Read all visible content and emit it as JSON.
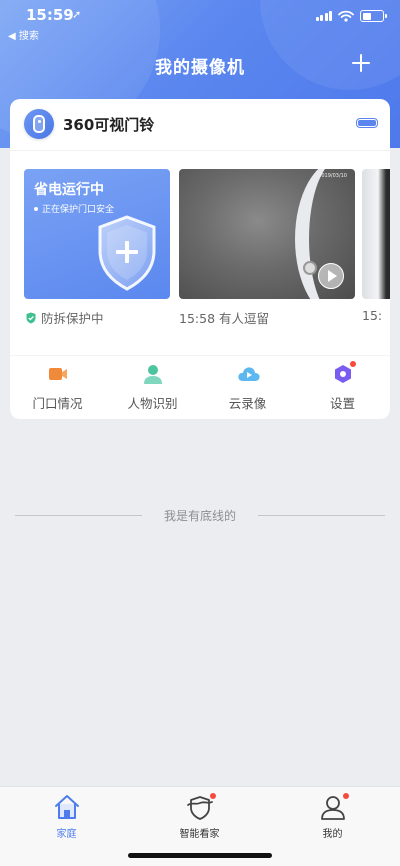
{
  "status_bar": {
    "time": "15:59",
    "back_label": "◀ 搜索"
  },
  "header": {
    "title": "我的摄像机",
    "add_icon": "plus-icon"
  },
  "device": {
    "name": "360可视门铃",
    "icon": "doorbell-icon",
    "battery_icon": "battery-full-icon"
  },
  "tiles": {
    "status": {
      "title": "省电运行中",
      "subtitle": "正在保护门口安全",
      "caption": "防拆保护中"
    },
    "video1": {
      "stamp": "2019/03/10",
      "caption": "15:58 有人逗留"
    },
    "video2": {
      "caption": "15:"
    }
  },
  "features": [
    {
      "label": "门口情况",
      "icon": "camera-icon",
      "color": "#f08a3a"
    },
    {
      "label": "人物识别",
      "icon": "person-icon",
      "color": "#4cc4a0"
    },
    {
      "label": "云录像",
      "icon": "cloud-play-icon",
      "color": "#5cb8f0"
    },
    {
      "label": "设置",
      "icon": "settings-hex-icon",
      "color": "#7a5cf0"
    }
  ],
  "footer_note": "我是有底线的",
  "tabbar": [
    {
      "label": "家庭",
      "icon": "home-icon"
    },
    {
      "label": "智能看家",
      "icon": "guard-shield-icon"
    },
    {
      "label": "我的",
      "icon": "profile-icon"
    }
  ],
  "colors": {
    "accent": "#4e7cec",
    "header_gradient_start": "#7da7f4",
    "header_gradient_end": "#4e79ec",
    "badge": "#f44b3c"
  }
}
